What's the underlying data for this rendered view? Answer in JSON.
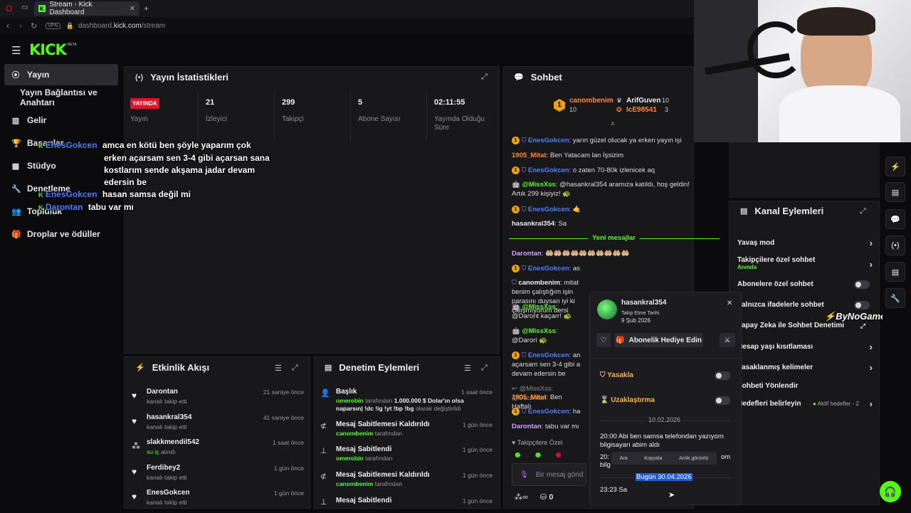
{
  "browser": {
    "tab_title": "Stream - Kick Dashboard",
    "url_domain": "dashboard.",
    "url_host": "kick.com",
    "url_path": "/stream",
    "vpn": "VPN"
  },
  "logo": {
    "text": "KICK",
    "beta": "BETA"
  },
  "sidebar": {
    "items": [
      {
        "label": "Yayın",
        "icon": "broadcast-icon"
      },
      {
        "label": "Yayın Bağlantısı ve Anahtarı",
        "icon": ""
      },
      {
        "label": "Gelir",
        "icon": "revenue-icon"
      },
      {
        "label": "Başarılar",
        "icon": "trophy-icon"
      },
      {
        "label": "Stüdyo",
        "icon": "studio-icon"
      },
      {
        "label": "Denetleme",
        "icon": "wrench-icon"
      },
      {
        "label": "Topluluk",
        "icon": "community-icon"
      },
      {
        "label": "Droplar ve ödüller",
        "icon": "gift-icon"
      }
    ]
  },
  "stats": {
    "title": "Yayın İstatistikleri",
    "live_badge": "YAYINDA",
    "live_label": "Yayın",
    "cols": [
      {
        "value": "21",
        "label": "İzleyici"
      },
      {
        "value": "299",
        "label": "Takipçi"
      },
      {
        "value": "5",
        "label": "Abone Sayısı"
      },
      {
        "value": "02:11:55",
        "label": "Yayında Olduğu Süre"
      }
    ]
  },
  "overlay": {
    "lines": [
      {
        "name": "EnesGokcen",
        "text": "amca en kötü ben şöyle yaparım çok"
      },
      {
        "name": "",
        "text": "erken açarsam sen 3-4 gibi açarsan sana"
      },
      {
        "name": "",
        "text": "kostlarım sende akşama jadar devam"
      },
      {
        "name": "",
        "text": "edersin be"
      },
      {
        "name": "EnesGokcen",
        "text": "hasan samsa değil mi"
      },
      {
        "name": "Darontan",
        "text": "tabu var mı"
      }
    ]
  },
  "chat": {
    "title": "Sohbet",
    "top": [
      {
        "rank": "1",
        "name": "canombenim",
        "count": "10"
      },
      {
        "name": "ArifGuven",
        "count": "10"
      },
      {
        "name": "IcE98541",
        "count": "3"
      }
    ],
    "messages": [
      {
        "name": "EnesGokcen",
        "style": "b",
        "badge": true,
        "text": ": yarın güzel olucak ya erken yayın işi"
      },
      {
        "name": "1905_Mitat",
        "style": "o",
        "badge": false,
        "text": ": Ben Yatacam lan İşsizim"
      },
      {
        "name": "EnesGokcen",
        "style": "b",
        "badge": true,
        "text": ": o zaten 70-80k izlenicek aq"
      },
      {
        "name": "@MissXss",
        "style": "g",
        "badge": false,
        "text": ": @hasankral354 aramıza katıldı, hoş geldin! Artık 299 kişiyiz! 🐢"
      },
      {
        "name": "EnesGokcen",
        "style": "b",
        "badge": true,
        "text": ": 🤙"
      },
      {
        "name": "hasankral354",
        "style": "w",
        "badge": false,
        "text": ": Sa"
      }
    ],
    "new_messages": "Yeni mesajlar",
    "messages2": [
      {
        "name": "Darontan",
        "style": "p",
        "text": ": 🤲🏼🤲🏼🤲🏼🤲🏼🤲🏼🤲🏼🤲🏼🤲🏼🤲🏼🤲🏼"
      },
      {
        "name": "EnesGokcen",
        "style": "b",
        "text": ": as"
      },
      {
        "name": "canombenim",
        "style": "w",
        "text": ": mitat benim çalıştığım işin parasını duysan iyi ki çalışmıyorum dersi"
      },
      {
        "name": "@MissXss",
        "style": "g",
        "text": ": @Daront kaçarr! 🐢"
      },
      {
        "name": "@MissXss",
        "style": "g",
        "text": ": @Darori 🐢"
      },
      {
        "name": "EnesGokcen",
        "style": "b",
        "text": ": an açarsam sen 3-4 gibi a devam edersin be"
      },
      {
        "name": "",
        "style": "w",
        "text": "↩ @MissXss: @Darontan"
      },
      {
        "name": "1905_Mitat",
        "style": "o",
        "text": ": Ben Haftalı"
      },
      {
        "name": "EnesGokcen",
        "style": "b",
        "text": ": ha"
      },
      {
        "name": "Darontan",
        "style": "p",
        "text": ": tabu var mı"
      }
    ],
    "followers_only": "Takipçilere Özel",
    "input_placeholder": "Bir mesaj gönd",
    "points": "0"
  },
  "activity": {
    "title": "Etkinlik Akışı",
    "items": [
      {
        "name": "Darontan",
        "sub": "kanalı takip etti",
        "time": "21 saniye önce",
        "icon": "heart-icon"
      },
      {
        "name": "hasankral354",
        "sub": "kanalı takip etti",
        "time": "41 saniye önce",
        "icon": "heart-icon"
      },
      {
        "name": "slakkmendil542",
        "sub": "su iç",
        "sub2": " alındı",
        "time": "1 saat önce",
        "icon": "points-icon"
      },
      {
        "name": "Ferdibey2",
        "sub": "kanalı takip etti",
        "time": "1 gün önce",
        "icon": "heart-icon"
      },
      {
        "name": "EnesGokcen",
        "sub": "kanalı takip etti",
        "time": "1 gün önce",
        "icon": "heart-icon"
      }
    ]
  },
  "moderation": {
    "title": "Denetim Eylemleri",
    "items": [
      {
        "name": "Başlık",
        "by": "omerobin",
        "mid": " tarafından ",
        "value": "1.000.000 $ Dolar'ın olsa naparsın| !dc !ig !yt !bp !bg",
        "tail": " olarak değiştirildi",
        "time": "1 saat önce",
        "icon": "title-icon"
      },
      {
        "name": "Mesaj Sabitlemesi Kaldırıldı",
        "by": "canombenim",
        "mid": " tarafından",
        "time": "1 gün önce",
        "icon": "unpin-icon"
      },
      {
        "name": "Mesaj Sabitlendi",
        "by": "omerobin",
        "mid": " tarafından",
        "time": "1 gün önce",
        "icon": "pin-icon"
      },
      {
        "name": "Mesaj Sabitlemesi Kaldırıldı",
        "by": "canombenim",
        "mid": " tarafından",
        "time": "1 gün önce",
        "icon": "unpin-icon"
      },
      {
        "name": "Mesaj Sabitlendi",
        "by": "",
        "mid": "",
        "time": "1 gün önce",
        "icon": "pin-icon"
      }
    ]
  },
  "channel_actions": {
    "title": "Kanal Eylemleri",
    "items": [
      {
        "label": "Yavaş mod",
        "type": "arrow"
      },
      {
        "label": "Takipçilere özel sohbet",
        "sub": "Anında",
        "type": "arrow"
      },
      {
        "label": "Abonelere özel sohbet",
        "type": "toggle"
      },
      {
        "label": "Yalnızca ifadelerle sohbet",
        "type": "toggle"
      },
      {
        "label": "Yapay Zeka ile Sohbet Denetimi",
        "type": "external"
      },
      {
        "label": "Hesap yaşı kısıtlaması",
        "type": "arrow"
      },
      {
        "label": "Yasaklanmış kelimeler",
        "type": "arrow"
      },
      {
        "label": "Sohbeti Yönlendir",
        "type": "none"
      },
      {
        "label": "Hedefleri belirleyin",
        "sub": "Aktif hedefler - 2",
        "type": "arrow"
      }
    ]
  },
  "user_card": {
    "name": "hasankral354",
    "follow_label": "Takip Etme Tarihi",
    "follow_date": "9 Şub 2026",
    "gift_button": "Abonelik Hediye Edin",
    "ban_label": "Yasakla",
    "timeout_label": "Uzaklaştırma",
    "date1": "10.02.2026",
    "msg1": "20:00 Abi ben samsa telefondan yazıyom bilgisayarı abim aldı",
    "msg2": "20:",
    "msg2_tail": "om",
    "msg2_line2": "bilg",
    "ctx": [
      "Ara",
      "Kopyala",
      "Anlık görüntü"
    ],
    "date2": "Bugün 30.04.2026",
    "msg3": "23:23 Sa"
  },
  "watermark": "ByNoGame",
  "colors": {
    "accent": "#53fc18",
    "live": "#e0142c",
    "name_blue": "#4a7fff",
    "name_orange": "#ff8a2a"
  }
}
